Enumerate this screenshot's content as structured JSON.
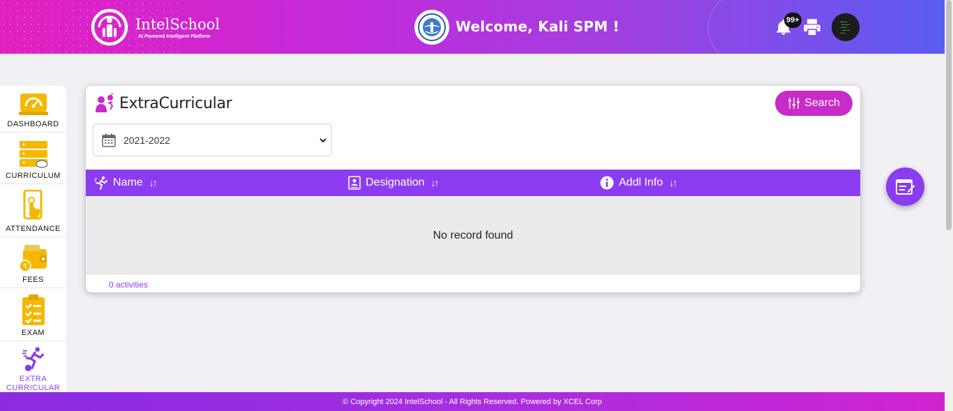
{
  "header": {
    "logo_name": "IntelSchool",
    "logo_tagline": "AI Powered Intelligent Platform",
    "welcome": "Welcome, Kali SPM !",
    "notification_count": "99+"
  },
  "sidebar": {
    "items": [
      {
        "label": "DASHBOARD",
        "icon": "dashboard-icon"
      },
      {
        "label": "CURRICULUM",
        "icon": "curriculum-icon"
      },
      {
        "label": "ATTENDANCE",
        "icon": "attendance-icon"
      },
      {
        "label": "FEES",
        "icon": "fees-icon"
      },
      {
        "label": "EXAM",
        "icon": "exam-icon"
      },
      {
        "label": "EXTRA CURRICULAR",
        "icon": "extra-curricular-icon",
        "active": true
      }
    ]
  },
  "page": {
    "title": "ExtraCurricular",
    "search_label": "Search",
    "year_selected": "2021-2022"
  },
  "table": {
    "columns": [
      {
        "label": "Name",
        "icon": "runner-icon"
      },
      {
        "label": "Designation",
        "icon": "id-card-icon"
      },
      {
        "label": "Addl Info",
        "icon": "info-icon"
      }
    ],
    "empty_message": "No record found",
    "count_label": "0 activities"
  },
  "footer": {
    "text": "© Copyright 2024 IntelSchool - All Rights Reserved. Powered by XCEL Corp"
  },
  "colors": {
    "primary_purple": "#8c3cf0",
    "accent_magenta": "#c82bc8",
    "icon_yellow": "#f5b800"
  }
}
